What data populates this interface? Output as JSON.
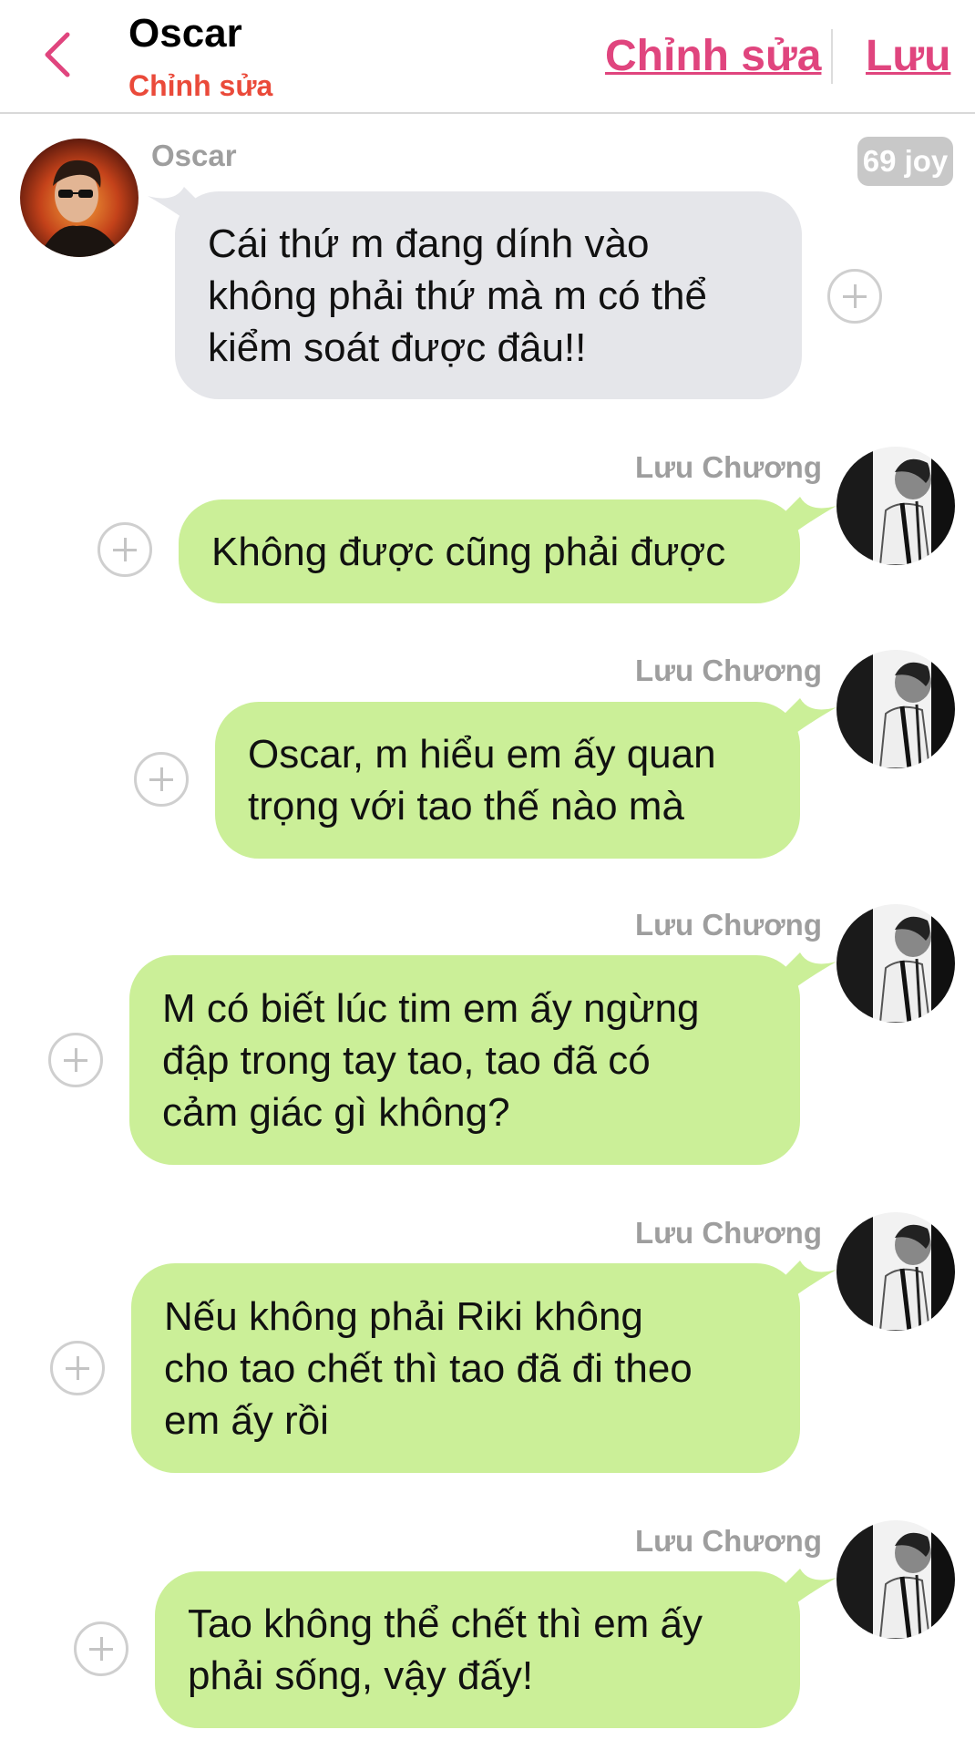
{
  "header": {
    "title": "Oscar",
    "subtitle": "Chỉnh sửa",
    "edit_label": "Chỉnh sửa",
    "save_label": "Lưu",
    "back_icon": "chevron-left-icon",
    "accent_color": "#e0457e"
  },
  "messages": [
    {
      "sender": "Oscar",
      "direction": "incoming",
      "badge": "69 joy",
      "lines": [
        "Cái thứ m đang dính vào",
        "không phải thứ mà m có thể",
        "kiểm soát được đâu!!"
      ]
    },
    {
      "sender": "Lưu Chương",
      "direction": "outgoing",
      "lines": [
        "Không được cũng phải được"
      ]
    },
    {
      "sender": "Lưu Chương",
      "direction": "outgoing",
      "lines": [
        "Oscar, m hiểu em ấy quan",
        "trọng với tao thế nào mà"
      ]
    },
    {
      "sender": "Lưu Chương",
      "direction": "outgoing",
      "lines": [
        "M có biết lúc tim em ấy ngừng",
        "đập trong tay tao, tao đã có",
        "cảm giác gì không?"
      ]
    },
    {
      "sender": "Lưu Chương",
      "direction": "outgoing",
      "lines": [
        "Nếu không phải Riki không",
        "cho tao chết thì tao đã đi theo",
        "em ấy rồi"
      ]
    },
    {
      "sender": "Lưu Chương",
      "direction": "outgoing",
      "lines": [
        "Tao không thể chết thì em ấy",
        "phải sống, vậy đấy!"
      ]
    }
  ],
  "colors": {
    "incoming_bubble": "#e5e6ea",
    "outgoing_bubble": "#cbef98",
    "subtitle": "#ea4a3a"
  }
}
